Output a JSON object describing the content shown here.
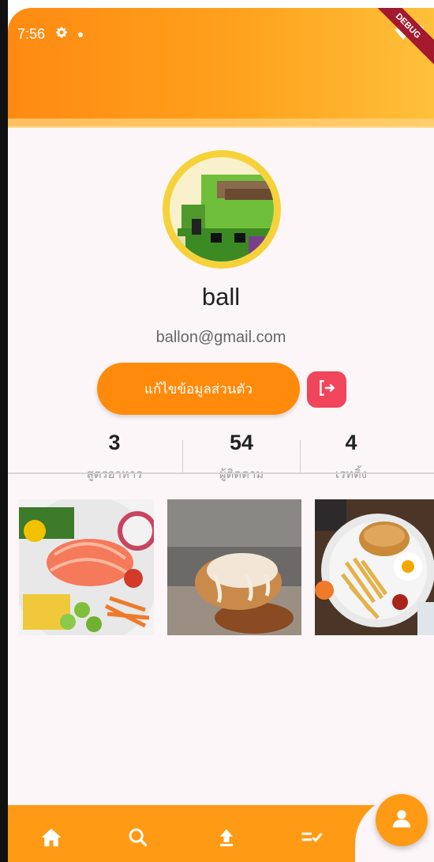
{
  "status_bar": {
    "time": "7:56",
    "debug_label": "DEBUG"
  },
  "profile": {
    "name": "ball",
    "email": "ballon@gmail.com",
    "edit_button_label": "แก้ไขข้อมูลส่วนตัว"
  },
  "stats": [
    {
      "value": "3",
      "label": "สูตรอาหาร"
    },
    {
      "value": "54",
      "label": "ผู้ติดตาม"
    },
    {
      "value": "4",
      "label": "เรทติ้ง"
    }
  ],
  "photos": [
    "salmon-salad",
    "bread-bun",
    "burger-fries-plate"
  ],
  "nav": {
    "items": [
      "home-icon",
      "search-icon",
      "upload-icon",
      "checklist-icon"
    ],
    "fab": "person-icon"
  },
  "colors": {
    "accent": "#ff8a0c",
    "logout": "#f0455a",
    "avatar_ring": "#f6d23a"
  }
}
